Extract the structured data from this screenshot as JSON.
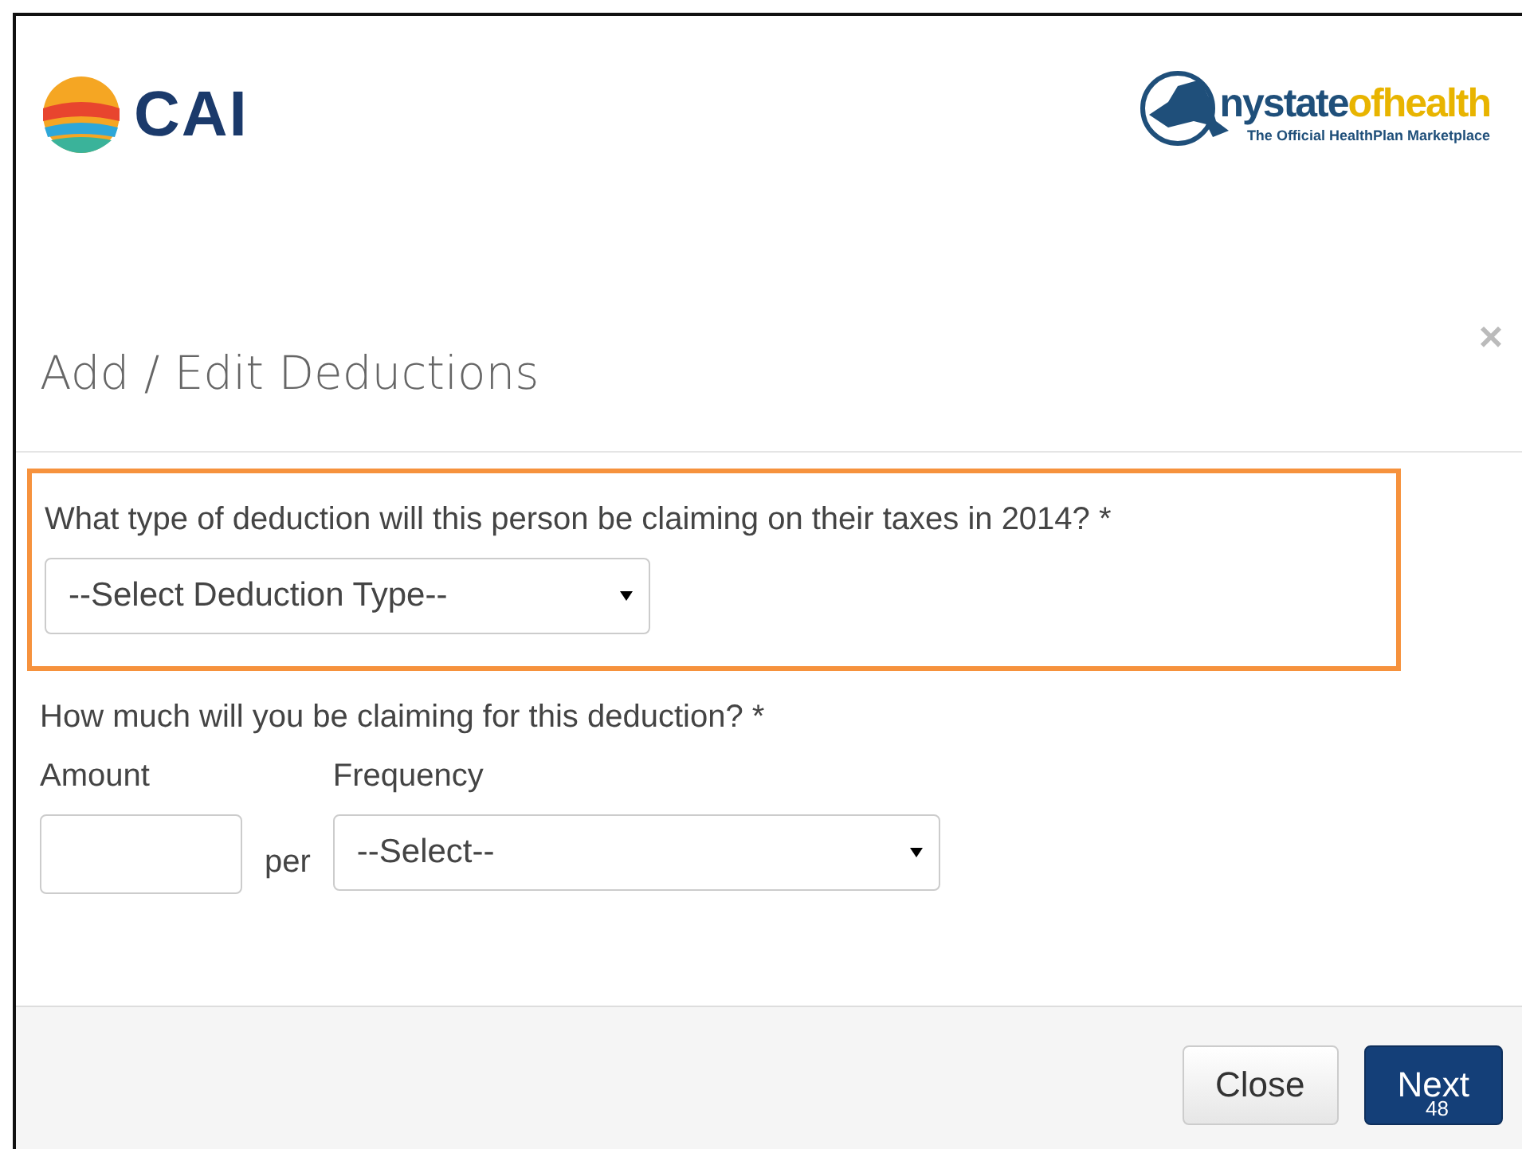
{
  "slide": {
    "logo_left": "CAI",
    "logo_right": {
      "name_part1": "nystate",
      "name_part2": "ofhealth",
      "tagline": "The Official HealthPlan Marketplace"
    },
    "page_number": "48"
  },
  "dialog": {
    "title": "Add / Edit Deductions",
    "close_icon": "×",
    "question": {
      "label": "What type of deduction will this person be claiming on their taxes in 2014? *",
      "select": "--Select Deduction Type--",
      "highlighted": true
    },
    "amount_question": "How much will you be claiming for this deduction? *",
    "amount_label": "Amount",
    "per": "per",
    "frequency_label": "Frequency",
    "frequency_select": "--Select--",
    "buttons": [
      {
        "label": "Close",
        "kind": "default"
      },
      {
        "label": "Next",
        "kind": "primary"
      }
    ]
  }
}
